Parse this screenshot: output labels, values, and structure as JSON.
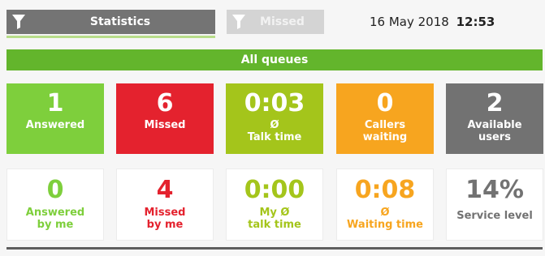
{
  "tabs": [
    {
      "label": "Statistics",
      "active": true
    },
    {
      "label": "Missed",
      "active": false
    }
  ],
  "datetime": {
    "date": "16 May 2018",
    "time": "12:53"
  },
  "queue_bar": {
    "label": "All queues"
  },
  "colors": {
    "answered": "#7ecf3c",
    "missed": "#e4222e",
    "talk": "#a4c51b",
    "waiting": "#f7a51f",
    "users": "#727272"
  },
  "stats_top": [
    {
      "value": "1",
      "label1": "Answered",
      "label2": ""
    },
    {
      "value": "6",
      "label1": "Missed",
      "label2": ""
    },
    {
      "value": "0:03",
      "label1": "Ø",
      "label2": "Talk time"
    },
    {
      "value": "0",
      "label1": "Callers",
      "label2": "waiting"
    },
    {
      "value": "2",
      "label1": "Available",
      "label2": "users"
    }
  ],
  "stats_bottom": [
    {
      "value": "0",
      "label1": "Answered",
      "label2": "by me"
    },
    {
      "value": "4",
      "label1": "Missed",
      "label2": "by me"
    },
    {
      "value": "0:00",
      "label1": "My Ø",
      "label2": "talk time"
    },
    {
      "value": "0:08",
      "label1": "Ø",
      "label2": "Waiting time"
    },
    {
      "value": "14%",
      "label1": "Service level",
      "label2": ""
    }
  ]
}
